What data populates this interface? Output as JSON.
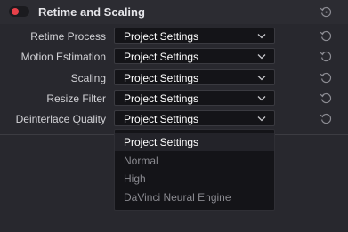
{
  "section": {
    "title": "Retime and Scaling",
    "enabled": true,
    "accent_color": "#e8414a"
  },
  "rows": [
    {
      "label": "Retime Process",
      "value": "Project Settings"
    },
    {
      "label": "Motion Estimation",
      "value": "Project Settings"
    },
    {
      "label": "Scaling",
      "value": "Project Settings"
    },
    {
      "label": "Resize Filter",
      "value": "Project Settings"
    },
    {
      "label": "Deinterlace Quality",
      "value": "Project Settings"
    }
  ],
  "dropdown": {
    "options": [
      "Project Settings",
      "Normal",
      "High",
      "DaVinci Neural Engine"
    ],
    "selected": "Project Settings"
  },
  "icons": {
    "reset": "reset-icon",
    "chevron": "chevron-down-icon",
    "toggle": "toggle-switch"
  }
}
